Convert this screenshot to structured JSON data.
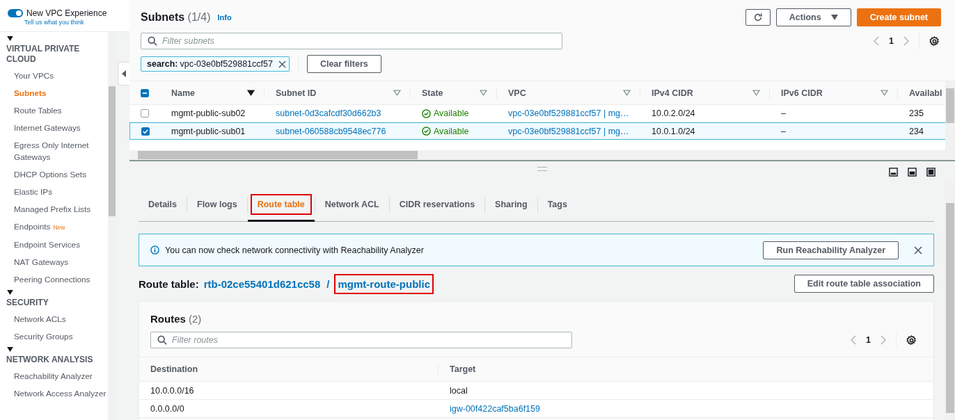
{
  "sidebar": {
    "toggle": {
      "label": "New VPC Experience",
      "on": true
    },
    "feedback_link": "Tell us what you think",
    "sections": [
      {
        "title": "VIRTUAL PRIVATE CLOUD",
        "expanded": true,
        "items": [
          {
            "label": "Your VPCs",
            "selected": false
          },
          {
            "label": "Subnets",
            "selected": true
          },
          {
            "label": "Route Tables",
            "selected": false
          },
          {
            "label": "Internet Gateways",
            "selected": false
          },
          {
            "label": "Egress Only Internet Gateways",
            "selected": false
          },
          {
            "label": "DHCP Options Sets",
            "selected": false
          },
          {
            "label": "Elastic IPs",
            "selected": false
          },
          {
            "label": "Managed Prefix Lists",
            "selected": false
          },
          {
            "label": "Endpoints",
            "selected": false,
            "badge": "New"
          },
          {
            "label": "Endpoint Services",
            "selected": false
          },
          {
            "label": "NAT Gateways",
            "selected": false
          },
          {
            "label": "Peering Connections",
            "selected": false
          }
        ]
      },
      {
        "title": "SECURITY",
        "expanded": true,
        "items": [
          {
            "label": "Network ACLs",
            "selected": false
          },
          {
            "label": "Security Groups",
            "selected": false
          }
        ]
      },
      {
        "title": "NETWORK ANALYSIS",
        "expanded": true,
        "items": [
          {
            "label": "Reachability Analyzer",
            "selected": false
          },
          {
            "label": "Network Access Analyzer",
            "selected": false
          }
        ]
      }
    ]
  },
  "subnets": {
    "title": "Subnets",
    "count": "(1/4)",
    "info": "Info",
    "actions": "Actions",
    "create": "Create subnet",
    "filter_placeholder": "Filter subnets",
    "filter_token": {
      "key": "search:",
      "value": "vpc-03e0bf529881ccf57"
    },
    "clear": "Clear filters",
    "page": "1",
    "select_all_partial": true,
    "columns": [
      {
        "label": "Name",
        "sorted": true
      },
      {
        "label": "Subnet ID",
        "sorted": false
      },
      {
        "label": "State",
        "sorted": false
      },
      {
        "label": "VPC",
        "sorted": false
      },
      {
        "label": "IPv4 CIDR",
        "sorted": false
      },
      {
        "label": "IPv6 CIDR",
        "sorted": false
      },
      {
        "label": "Availabl"
      }
    ],
    "rows": [
      {
        "checked": false,
        "name": "mgmt-public-sub02",
        "subnet_id": "subnet-0d3cafcdf30d662b3",
        "state": "Available",
        "vpc": "vpc-03e0bf529881ccf57 | mg…",
        "ipv4": "10.0.2.0/24",
        "ipv6": "–",
        "available": "235"
      },
      {
        "checked": true,
        "name": "mgmt-public-sub01",
        "subnet_id": "subnet-060588cb9548ec776",
        "state": "Available",
        "vpc": "vpc-03e0bf529881ccf57 | mg…",
        "ipv4": "10.0.1.0/24",
        "ipv6": "–",
        "available": "234"
      }
    ]
  },
  "details": {
    "tabs": [
      {
        "label": "Details",
        "selected": false,
        "highlighted": false
      },
      {
        "label": "Flow logs",
        "selected": false,
        "highlighted": false
      },
      {
        "label": "Route table",
        "selected": true,
        "highlighted": true
      },
      {
        "label": "Network ACL",
        "selected": false,
        "highlighted": false
      },
      {
        "label": "CIDR reservations",
        "selected": false,
        "highlighted": false
      },
      {
        "label": "Sharing",
        "selected": false,
        "highlighted": false
      },
      {
        "label": "Tags",
        "selected": false,
        "highlighted": false
      }
    ],
    "alert": {
      "text": "You can now check network connectivity with Reachability Analyzer",
      "button": "Run Reachability Analyzer"
    },
    "route_table": {
      "label": "Route table:",
      "id": "rtb-02ce55401d621cc58",
      "separator": "/",
      "name": "mgmt-route-public",
      "name_highlighted": true,
      "edit_button": "Edit route table association"
    },
    "routes": {
      "title": "Routes",
      "count": "(2)",
      "filter_placeholder": "Filter routes",
      "page": "1",
      "columns": [
        "Destination",
        "Target"
      ],
      "rows": [
        {
          "destination": "10.0.0.0/16",
          "target": "local",
          "target_is_link": false
        },
        {
          "destination": "0.0.0.0/0",
          "target": "igw-00f422caf5ba6f159",
          "target_is_link": true
        }
      ]
    }
  }
}
